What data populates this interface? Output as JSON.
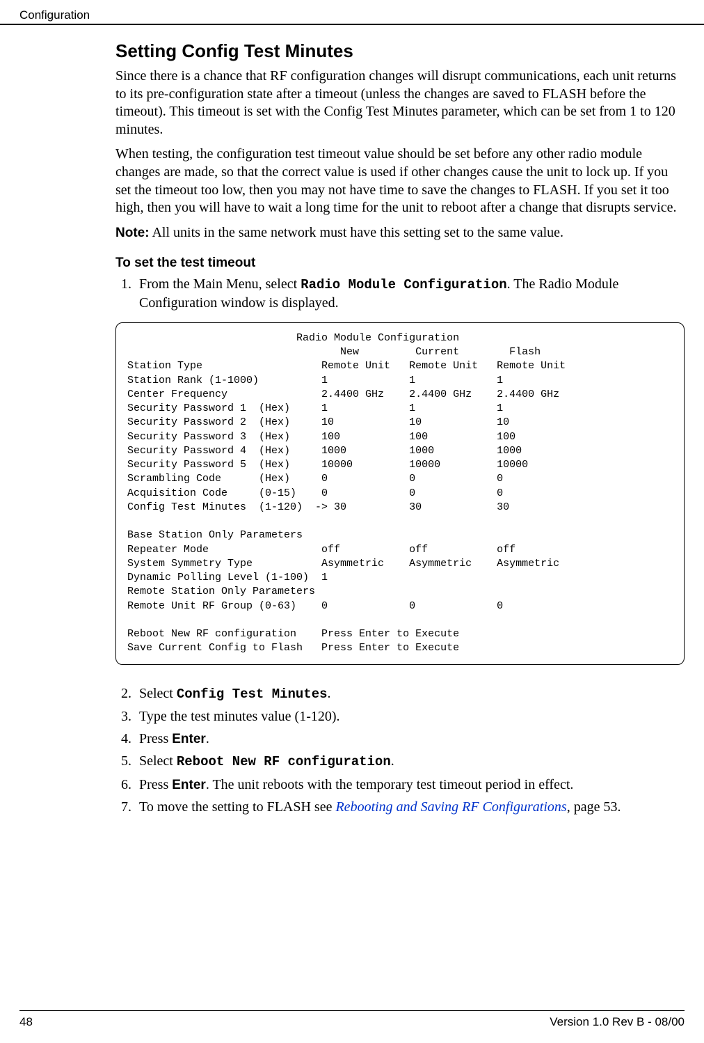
{
  "header": {
    "section": "Configuration"
  },
  "main": {
    "title": "Setting Config Test Minutes",
    "para1": "Since there is a chance that RF configuration changes will disrupt communications, each unit returns to its pre-configuration state after a timeout (unless the changes are saved to FLASH before the timeout). This timeout is set with the Config Test Minutes parameter, which can be set from 1 to 120 minutes.",
    "para2": "When testing, the configuration test timeout value should be set before any other radio module changes are made, so that the correct value is used if other changes cause the unit to lock up. If you set the timeout too low, then you may not have time to save the changes to FLASH. If you set it too high, then you will have to wait a long time for the unit to reboot after a change that disrupts service.",
    "note_label": "Note:",
    "note_text": " All units in the same network must have this setting set to the same value.",
    "sub_title": "To set the test timeout",
    "step1_a": "From the Main Menu, select ",
    "step1_cmd": "Radio Module Configuration",
    "step1_b": ". The Radio Module Configuration window is displayed.",
    "terminal": "                           Radio Module Configuration\n                                  New         Current        Flash\nStation Type                   Remote Unit   Remote Unit   Remote Unit\nStation Rank (1-1000)          1             1             1\nCenter Frequency               2.4400 GHz    2.4400 GHz    2.4400 GHz\nSecurity Password 1  (Hex)     1             1             1\nSecurity Password 2  (Hex)     10            10            10\nSecurity Password 3  (Hex)     100           100           100\nSecurity Password 4  (Hex)     1000          1000          1000\nSecurity Password 5  (Hex)     10000         10000         10000\nScrambling Code      (Hex)     0             0             0\nAcquisition Code     (0-15)    0             0             0\nConfig Test Minutes  (1-120)  -> 30          30            30\n\nBase Station Only Parameters\nRepeater Mode                  off           off           off\nSystem Symmetry Type           Asymmetric    Asymmetric    Asymmetric\nDynamic Polling Level (1-100)  1\nRemote Station Only Parameters\nRemote Unit RF Group (0-63)    0             0             0\n\nReboot New RF configuration    Press Enter to Execute\nSave Current Config to Flash   Press Enter to Execute",
    "step2_a": "Select ",
    "step2_cmd": "Config Test Minutes",
    "step2_b": ".",
    "step3": "Type the test minutes value (1-120).",
    "step4_a": "Press ",
    "step4_key": "Enter",
    "step4_b": ".",
    "step5_a": "Select ",
    "step5_cmd": "Reboot New RF configuration",
    "step5_b": ".",
    "step6_a": "Press ",
    "step6_key": "Enter",
    "step6_b": ". The unit reboots with the temporary test timeout period in effect.",
    "step7_a": "To move the setting to FLASH see ",
    "step7_link": "Rebooting and Saving RF Configurations",
    "step7_b": ", page 53."
  },
  "footer": {
    "page": "48",
    "version": "Version 1.0 Rev B - 08/00"
  }
}
